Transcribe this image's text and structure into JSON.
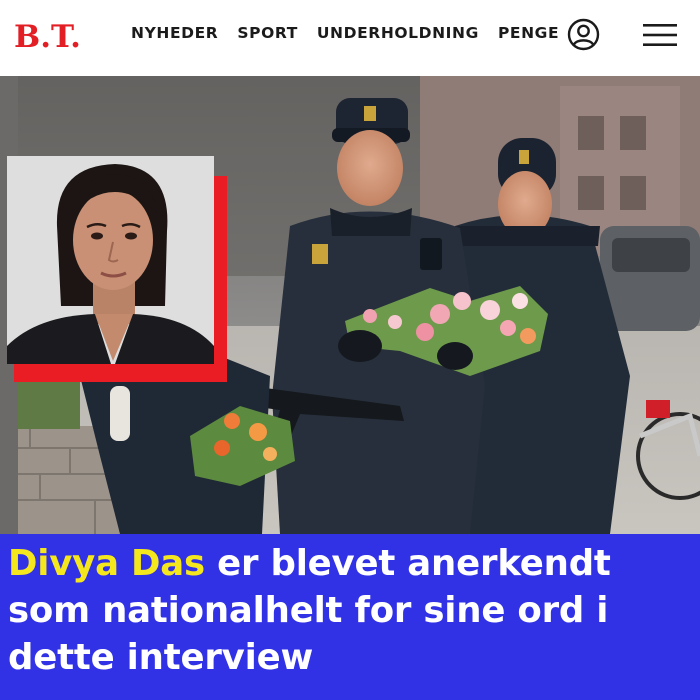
{
  "header": {
    "logo_text": "B.T.",
    "nav": [
      "NYHEDER",
      "SPORT",
      "UNDERHOLDNING",
      "PENGE"
    ],
    "icons": {
      "account": "user-circle-icon",
      "menu": "hamburger-menu-icon"
    }
  },
  "article": {
    "headline_highlight": "Divya Das",
    "headline_rest": " er blevet anerkendt som nationalhelt for sine ord i dette interview"
  },
  "colors": {
    "brand_red": "#e31f26",
    "headline_bg": "#3131e6",
    "highlight_yellow": "#f5e71e",
    "inset_frame_red": "#ea1c24"
  }
}
